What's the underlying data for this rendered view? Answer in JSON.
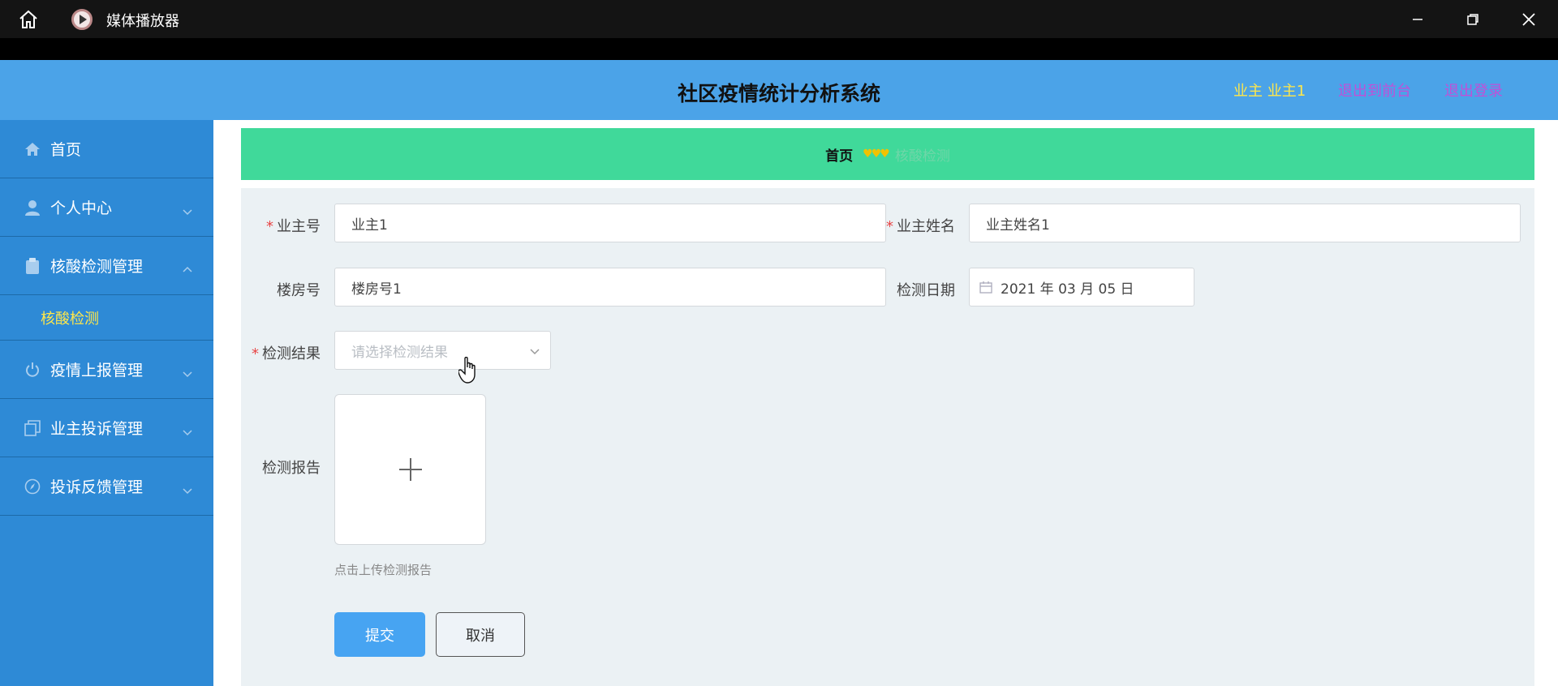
{
  "window": {
    "title": "媒体播放器"
  },
  "header": {
    "system_title": "社区疫情统计分析系统",
    "user_label": "业主 业主1",
    "back_link": "退出到前台",
    "logout_link": "退出登录"
  },
  "sidebar": {
    "items": [
      {
        "label": "首页",
        "icon": "home-icon"
      },
      {
        "label": "个人中心",
        "icon": "user-icon"
      },
      {
        "label": "核酸检测管理",
        "icon": "clipboard-icon"
      },
      {
        "label": "疫情上报管理",
        "icon": "power-icon"
      },
      {
        "label": "业主投诉管理",
        "icon": "copy-icon"
      },
      {
        "label": "投诉反馈管理",
        "icon": "compass-icon"
      }
    ],
    "sub_items": [
      {
        "label": "核酸检测"
      }
    ]
  },
  "breadcrumb": {
    "home": "首页",
    "hearts": "♥♥♥",
    "current": "核酸检测"
  },
  "form": {
    "owner_no_label": "业主号",
    "owner_no_value": "业主1",
    "owner_name_label": "业主姓名",
    "owner_name_value": "业主姓名1",
    "building_label": "楼房号",
    "building_value": "楼房号1",
    "date_label": "检测日期",
    "date_value": "2021 年 03 月 05 日",
    "result_label": "检测结果",
    "result_placeholder": "请选择检测结果",
    "report_label": "检测报告",
    "upload_hint": "点击上传检测报告",
    "submit_label": "提交",
    "cancel_label": "取消"
  },
  "colors": {
    "header_bg": "#4ba3e8",
    "sidebar_bg": "#2e8ad6",
    "breadcrumb_bg": "#40d99a",
    "accent_yellow": "#ffe74a",
    "link_purple": "#c050d8",
    "primary_button": "#47a4f2"
  }
}
